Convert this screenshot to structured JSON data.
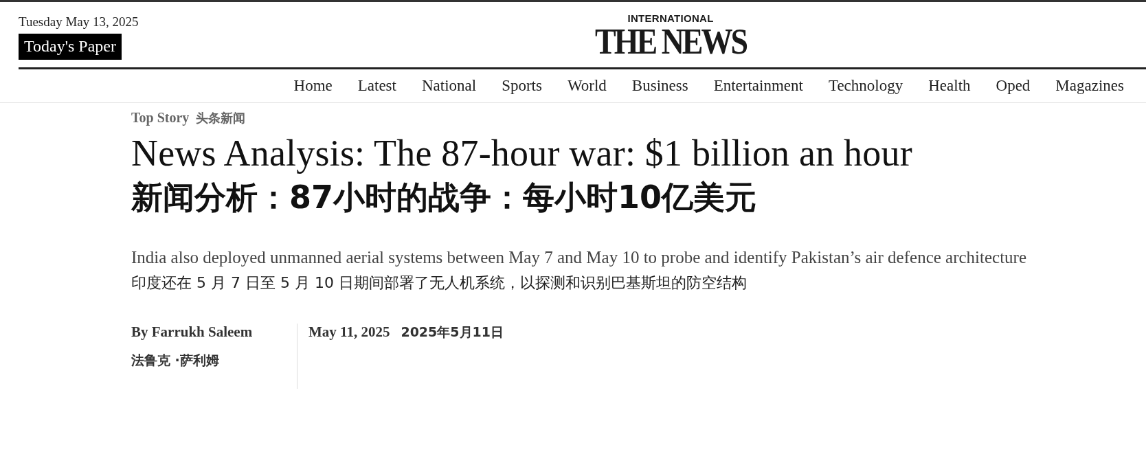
{
  "header": {
    "date": "Tuesday May 13, 2025",
    "todays_paper": "Today's Paper",
    "logo": {
      "kicker": "INTERNATIONAL",
      "wordmark": "THE NEWS"
    }
  },
  "nav": {
    "items": [
      {
        "label": "Home"
      },
      {
        "label": "Latest"
      },
      {
        "label": "National"
      },
      {
        "label": "Sports"
      },
      {
        "label": "World"
      },
      {
        "label": "Business"
      },
      {
        "label": "Entertainment"
      },
      {
        "label": "Technology"
      },
      {
        "label": "Health"
      },
      {
        "label": "Oped"
      },
      {
        "label": "Magazines"
      }
    ]
  },
  "article": {
    "category": "Top Story",
    "category_translation": "头条新闻",
    "headline": "News Analysis: The 87-hour war: $1 billion an hour",
    "headline_translation": "新闻分析：87小时的战争：每小时10亿美元",
    "summary": "India also deployed unmanned aerial systems between May 7 and May 10 to probe and identify Pakistan’s air defence architecture",
    "summary_translation": "印度还在 5 月 7 日至 5 月 10 日期间部署了无人机系统，以探测和识别巴基斯坦的防空结构",
    "byline": "By Farrukh Saleem",
    "byline_translation": "法鲁克 ·萨利姆",
    "date": "May 11, 2025",
    "date_translation": "2025年5月11日"
  }
}
